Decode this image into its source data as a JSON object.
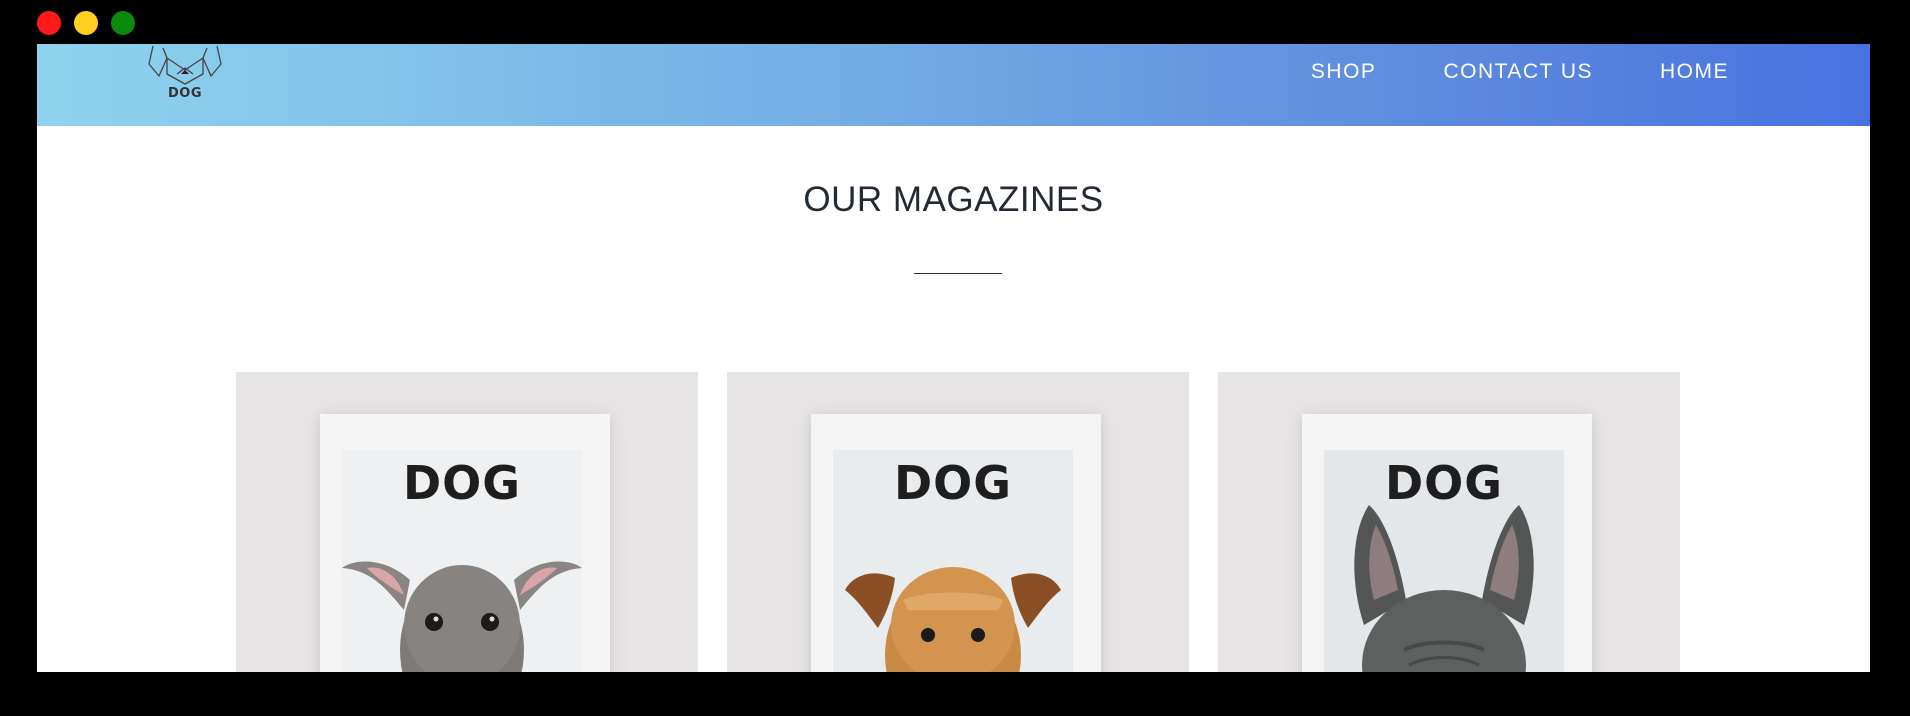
{
  "window": {
    "controls": [
      "close",
      "minimize",
      "maximize"
    ]
  },
  "navbar": {
    "logo_text": "DOG",
    "links": [
      {
        "label": "SHOP"
      },
      {
        "label": "CONTACT US"
      },
      {
        "label": "HOME"
      }
    ],
    "gradient_colors": [
      "#8fd3ee",
      "#4872e0"
    ]
  },
  "main": {
    "section_title": "OUR MAGAZINES",
    "magazines": [
      {
        "cover_title": "DOG",
        "dog": "italian-greyhound"
      },
      {
        "cover_title": "DOG",
        "dog": "airedale-terrier"
      },
      {
        "cover_title": "DOG",
        "dog": "french-bulldog"
      }
    ]
  },
  "colors": {
    "card_background": "#e6e4e4",
    "title_text": "#222a33"
  }
}
